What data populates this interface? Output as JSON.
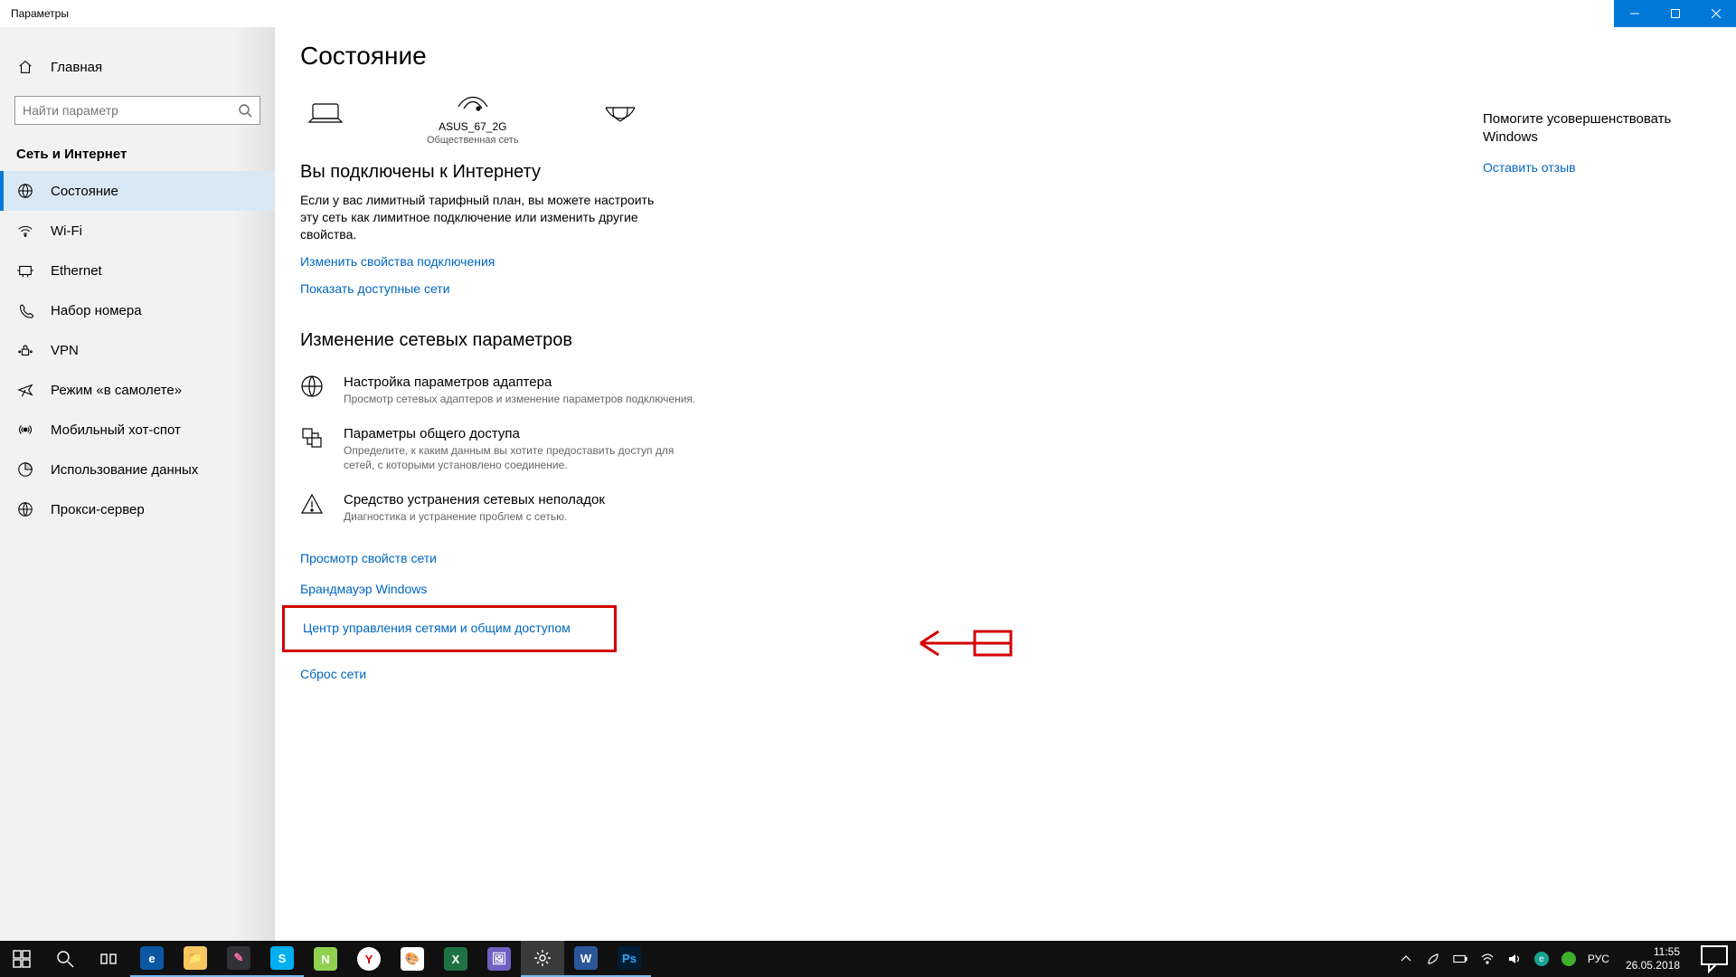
{
  "window": {
    "title": "Параметры"
  },
  "sidebar": {
    "home": "Главная",
    "search_placeholder": "Найти параметр",
    "category": "Сеть и Интернет",
    "items": [
      {
        "label": "Состояние"
      },
      {
        "label": "Wi-Fi"
      },
      {
        "label": "Ethernet"
      },
      {
        "label": "Набор номера"
      },
      {
        "label": "VPN"
      },
      {
        "label": "Режим «в самолете»"
      },
      {
        "label": "Мобильный хот-спот"
      },
      {
        "label": "Использование данных"
      },
      {
        "label": "Прокси-сервер"
      }
    ]
  },
  "main": {
    "heading": "Состояние",
    "network": {
      "ssid": "ASUS_67_2G",
      "type": "Общественная сеть"
    },
    "connected_heading": "Вы подключены к Интернету",
    "connected_body": "Если у вас лимитный тарифный план, вы можете настроить эту сеть как лимитное подключение или изменить другие свойства.",
    "link_change_props": "Изменить свойства подключения",
    "link_show_networks": "Показать доступные сети",
    "change_heading": "Изменение сетевых параметров",
    "opts": [
      {
        "title": "Настройка параметров адаптера",
        "desc": "Просмотр сетевых адаптеров и изменение параметров подключения."
      },
      {
        "title": "Параметры общего доступа",
        "desc": "Определите, к каким данным вы хотите предоставить доступ для сетей, с которыми установлено соединение."
      },
      {
        "title": "Средство устранения сетевых неполадок",
        "desc": "Диагностика и устранение проблем с сетью."
      }
    ],
    "link_view_props": "Просмотр свойств сети",
    "link_firewall": "Брандмауэр Windows",
    "link_sharing_center": "Центр управления сетями и общим доступом",
    "link_reset": "Сброс сети"
  },
  "rightpane": {
    "title": "Помогите усовершенствовать Windows",
    "feedback": "Оставить отзыв"
  },
  "taskbar": {
    "lang": "РУС",
    "time": "11:55",
    "date": "26.05.2018"
  }
}
